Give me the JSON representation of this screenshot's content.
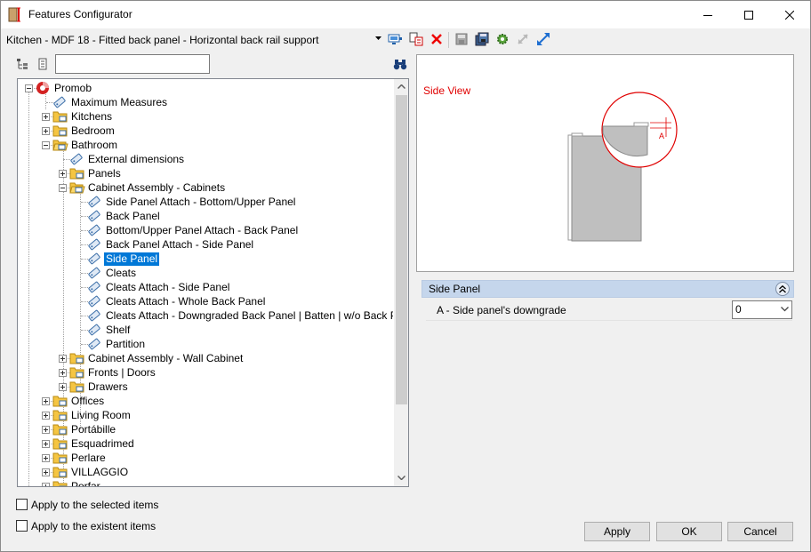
{
  "window": {
    "title": "Features Configurator",
    "controls": [
      "minimize",
      "maximize",
      "close"
    ]
  },
  "toolbar": {
    "breadcrumb": "Kitchen - MDF 18 - Fitted back panel - Horizontal back rail support",
    "icons": [
      "monitor-icon",
      "paste-icon",
      "delete-icon",
      "save-icon",
      "save-all-icon",
      "settings-icon",
      "collapse-arrows-icon",
      "expand-arrows-icon"
    ]
  },
  "search": {
    "value": "",
    "icons": [
      "sort-tree-icon",
      "list-icon",
      "binoculars-icon"
    ]
  },
  "tree": {
    "nodes": [
      {
        "label": "Promob",
        "level": 0,
        "expander": "minus",
        "icon": "promob-logo-icon"
      },
      {
        "label": "Maximum Measures",
        "level": 1,
        "expander": "none",
        "icon": "tag-icon"
      },
      {
        "label": "Kitchens",
        "level": 1,
        "expander": "plus",
        "icon": "folder-icon"
      },
      {
        "label": "Bedroom",
        "level": 1,
        "expander": "plus",
        "icon": "folder-icon"
      },
      {
        "label": "Bathroom",
        "level": 1,
        "expander": "minus",
        "icon": "folder-open-icon"
      },
      {
        "label": "External dimensions",
        "level": 2,
        "expander": "none",
        "icon": "tag-icon"
      },
      {
        "label": "Panels",
        "level": 2,
        "expander": "plus",
        "icon": "folder-icon"
      },
      {
        "label": "Cabinet Assembly - Cabinets",
        "level": 2,
        "expander": "minus",
        "icon": "folder-open-icon"
      },
      {
        "label": "Side Panel Attach - Bottom/Upper Panel",
        "level": 3,
        "expander": "none",
        "icon": "tag-icon"
      },
      {
        "label": "Back Panel",
        "level": 3,
        "expander": "none",
        "icon": "tag-icon"
      },
      {
        "label": " Bottom/Upper Panel Attach - Back Panel",
        "level": 3,
        "expander": "none",
        "icon": "tag-icon"
      },
      {
        "label": "Back Panel Attach - Side Panel",
        "level": 3,
        "expander": "none",
        "icon": "tag-icon"
      },
      {
        "label": "Side Panel",
        "level": 3,
        "expander": "none",
        "icon": "tag-icon",
        "selected": true
      },
      {
        "label": "Cleats",
        "level": 3,
        "expander": "none",
        "icon": "tag-icon"
      },
      {
        "label": "Cleats Attach - Side Panel",
        "level": 3,
        "expander": "none",
        "icon": "tag-icon"
      },
      {
        "label": "Cleats Attach - Whole Back Panel",
        "level": 3,
        "expander": "none",
        "icon": "tag-icon"
      },
      {
        "label": "Cleats Attach - Downgraded Back Panel | Batten | w/o Back Panel",
        "level": 3,
        "expander": "none",
        "icon": "tag-icon"
      },
      {
        "label": "Shelf",
        "level": 3,
        "expander": "none",
        "icon": "tag-icon"
      },
      {
        "label": "Partition",
        "level": 3,
        "expander": "none",
        "icon": "tag-icon"
      },
      {
        "label": "Cabinet Assembly - Wall Cabinet",
        "level": 2,
        "expander": "plus",
        "icon": "folder-icon"
      },
      {
        "label": "Fronts | Doors",
        "level": 2,
        "expander": "plus",
        "icon": "folder-icon"
      },
      {
        "label": "Drawers",
        "level": 2,
        "expander": "plus",
        "icon": "folder-icon"
      },
      {
        "label": "Offices",
        "level": 1,
        "expander": "plus",
        "icon": "folder-icon"
      },
      {
        "label": "Living Room",
        "level": 1,
        "expander": "plus",
        "icon": "folder-icon"
      },
      {
        "label": "Portábille",
        "level": 1,
        "expander": "plus",
        "icon": "folder-icon"
      },
      {
        "label": "Esquadrimed",
        "level": 1,
        "expander": "plus",
        "icon": "folder-icon"
      },
      {
        "label": "Perlare",
        "level": 1,
        "expander": "plus",
        "icon": "folder-icon"
      },
      {
        "label": "VILLAGGIO",
        "level": 1,
        "expander": "plus",
        "icon": "folder-icon"
      },
      {
        "label": "Porfar",
        "level": 1,
        "expander": "plus",
        "icon": "folder-icon"
      }
    ]
  },
  "preview": {
    "view_label": "Side View",
    "detail_label": "A",
    "accent_color": "#e00000"
  },
  "properties": {
    "section_title": "Side Panel",
    "rows": [
      {
        "label": "A - Side panel's downgrade",
        "value": "0"
      }
    ]
  },
  "options": {
    "apply_selected": "Apply to the selected items",
    "apply_existent": "Apply to the existent items"
  },
  "buttons": {
    "apply": "Apply",
    "ok": "OK",
    "cancel": "Cancel"
  }
}
